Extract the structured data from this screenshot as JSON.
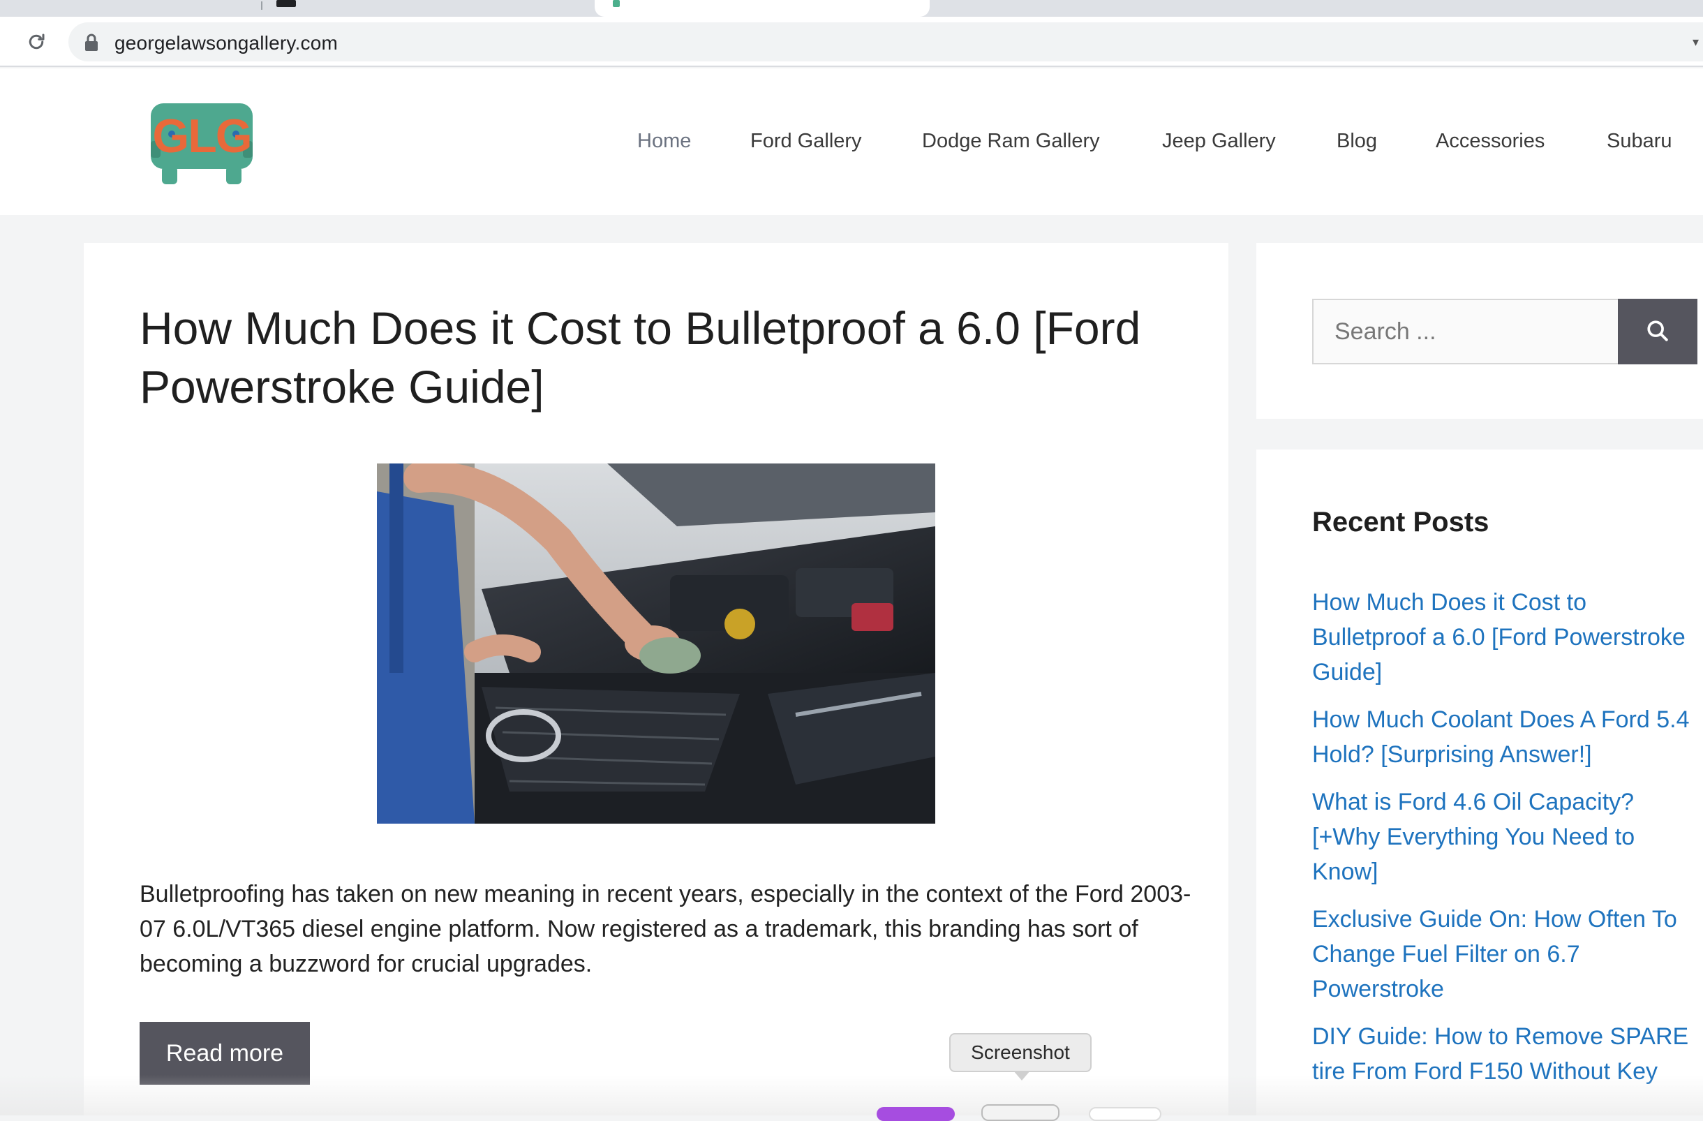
{
  "browser": {
    "url": "georgelawsongallery.com"
  },
  "site": {
    "logo_text": "GLG",
    "nav": [
      {
        "label": "Home"
      },
      {
        "label": "Ford Gallery"
      },
      {
        "label": "Dodge Ram Gallery"
      },
      {
        "label": "Jeep Gallery"
      },
      {
        "label": "Blog"
      },
      {
        "label": "Accessories"
      },
      {
        "label": "Subaru"
      }
    ]
  },
  "post": {
    "title": "How Much Does it Cost to Bulletproof a 6.0 [Ford Powerstroke Guide]",
    "excerpt": "Bulletproofing has taken on new meaning in recent years, especially in the context of the Ford 2003-07 6.0L/VT365 diesel engine platform. Now registered as a trademark, this branding has sort of becoming a buzzword for crucial upgrades.",
    "read_more": "Read more"
  },
  "sidebar": {
    "search_placeholder": "Search ...",
    "recent_title": "Recent Posts",
    "recent_posts": [
      "How Much Does it Cost to Bulletproof a 6.0 [Ford Powerstroke Guide]",
      "How Much Coolant Does A Ford 5.4 Hold? [Surprising Answer!]",
      "What is Ford 4.6 Oil Capacity? [+Why Everything You Need to Know]",
      "Exclusive Guide On: How Often To Change Fuel Filter on 6.7 Powerstroke",
      "DIY Guide: How to Remove SPARE tire From Ford F150 Without Key"
    ]
  },
  "overlay": {
    "tooltip": "Screenshot"
  },
  "colors": {
    "link": "#1e73be",
    "button": "#55555e",
    "logo_green": "#4ea88f",
    "logo_orange": "#e8693a"
  }
}
